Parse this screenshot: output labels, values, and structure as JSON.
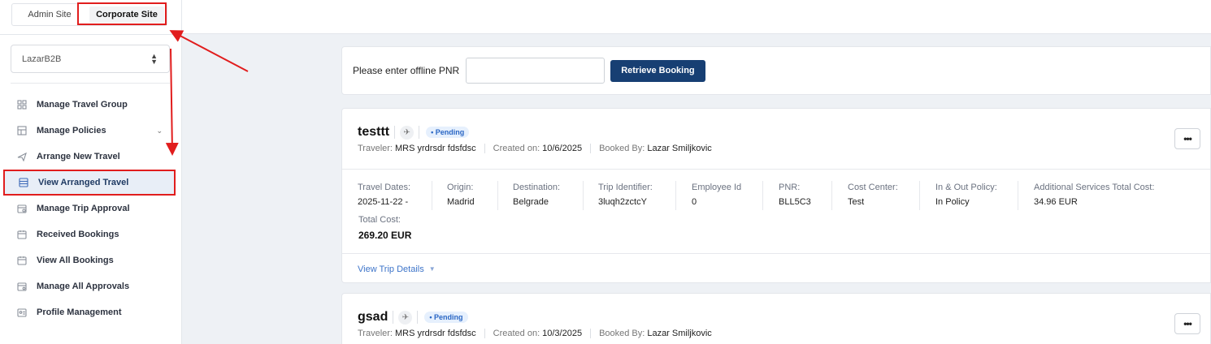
{
  "site_tabs": {
    "admin": "Admin Site",
    "corporate": "Corporate Site"
  },
  "company_select": {
    "value": "LazarB2B"
  },
  "nav": [
    {
      "label": "Manage Travel Group",
      "icon": "grid-icon"
    },
    {
      "label": "Manage Policies",
      "icon": "table-icon"
    },
    {
      "label": "Arrange New Travel",
      "icon": "plane-icon"
    },
    {
      "label": "View Arranged Travel",
      "icon": "list-icon"
    },
    {
      "label": "Manage Trip Approval",
      "icon": "calendar-check-icon"
    },
    {
      "label": "Received Bookings",
      "icon": "calendar-icon"
    },
    {
      "label": "View All Bookings",
      "icon": "calendar-icon"
    },
    {
      "label": "Manage All Approvals",
      "icon": "calendar-gear-icon"
    },
    {
      "label": "Profile Management",
      "icon": "id-card-icon"
    }
  ],
  "pnr": {
    "label": "Please enter offline PNR",
    "value": "",
    "button": "Retrieve Booking"
  },
  "meta_labels": {
    "traveler": "Traveler:",
    "created": "Created on:",
    "booked_by": "Booked By:"
  },
  "field_labels": {
    "travel_dates": "Travel Dates:",
    "origin": "Origin:",
    "destination": "Destination:",
    "trip_identifier": "Trip Identifier:",
    "employee_id": "Employee Id",
    "pnr": "PNR:",
    "cost_center": "Cost Center:",
    "policy": "In & Out Policy:",
    "additional": "Additional Services Total Cost:",
    "total": "Total Cost:"
  },
  "view_trip_details": "View Trip Details",
  "more_label": "•••",
  "bookings": [
    {
      "name": "testtt",
      "status": "• Pending",
      "traveler": "MRS yrdrsdr fdsfdsc",
      "created_on": "10/6/2025",
      "booked_by": "Lazar Smiljkovic",
      "travel_dates": "2025-11-22 -",
      "origin": "Madrid",
      "destination": "Belgrade",
      "trip_identifier": "3luqh2zctcY",
      "employee_id": "0",
      "pnr": "BLL5C3",
      "cost_center": "Test",
      "policy": "In Policy",
      "additional": "34.96 EUR",
      "total": "269.20 EUR"
    },
    {
      "name": "gsad",
      "status": "• Pending",
      "traveler": "MRS yrdrsdr fdsfdsc",
      "created_on": "10/3/2025",
      "booked_by": "Lazar Smiljkovic"
    }
  ],
  "colors": {
    "primary": "#173f73",
    "highlight": "#e11d1d",
    "badge_text": "#2a66c4",
    "link": "#3d74c9"
  }
}
